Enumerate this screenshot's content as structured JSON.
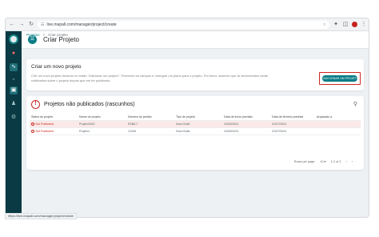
{
  "browser": {
    "url": "live.mapall.com/manager/project/create"
  },
  "appbar": {
    "title": "Criar Projeto"
  },
  "breadcrumb": {
    "root": "Projetos",
    "separator": ">",
    "current": "Criar projeto"
  },
  "create_card": {
    "title": "Criar um novo projeto",
    "description": "Crie um novo projeto clicando no botão \"Adicionar um projeto\". Preencha os campos e carregue um plano para o projeto. Por favor, observe que os terceirizados serão notificados sobre o projeto depois que ele for publicado.",
    "add_button": "+ ADICIONAR UM PROJETO"
  },
  "unpublished": {
    "title": "Projetos não publicados (rascunhos)",
    "columns": [
      "Status do projeto",
      "Nome do projeto",
      "Número do pedido",
      "Tipo de projeto",
      "Data de início prevista",
      "Data de término prevista",
      "Arquivado a"
    ],
    "rows": [
      [
        "Not Published",
        "Projeto2000",
        "ESB8-7",
        "Novo Build",
        "24/05/2024",
        "31/07/2024",
        ""
      ],
      [
        "Not Published",
        "Projeto1",
        "12345",
        "Novo Build",
        "24/05/2024",
        "31/07/2024",
        ""
      ]
    ],
    "pager": {
      "rows_per_page_label": "Rows per page:",
      "rows_per_page": "10",
      "range": "1-2 of 2"
    }
  },
  "statusbar": {
    "text": "https://live.mapall.com/manager/project/create"
  },
  "colors": {
    "accent": "#0a7d86",
    "sidebar": "#0a3a43",
    "alert": "#c8281f"
  }
}
